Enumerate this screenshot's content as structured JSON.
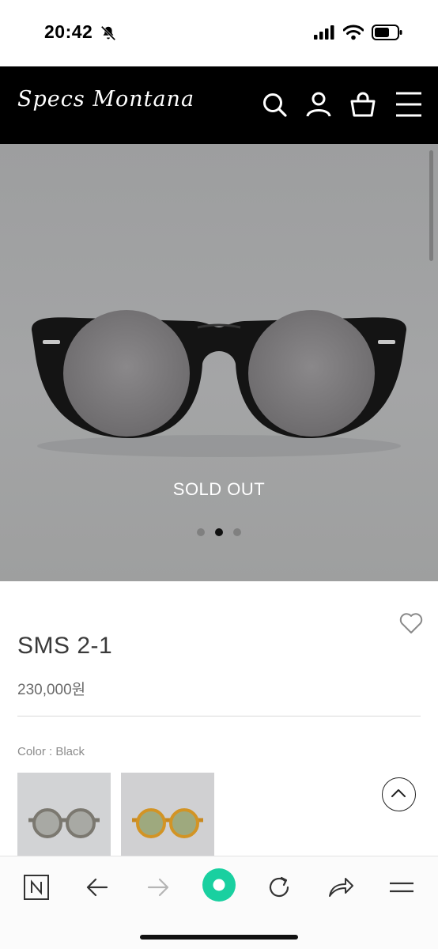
{
  "status_bar": {
    "time": "20:42",
    "icons": [
      "bell-off-icon",
      "cellular-signal-icon",
      "wifi-icon",
      "battery-icon"
    ]
  },
  "header": {
    "logo_text": "Specs Montana",
    "background": "#000000",
    "icons": [
      "search-icon",
      "account-icon",
      "cart-icon",
      "menu-icon"
    ]
  },
  "hero": {
    "badge": "SOLD OUT",
    "slide_count": 3,
    "active_slide": 2
  },
  "product": {
    "name": "SMS 2-1",
    "price": "230,000원",
    "color_label": "Color : Black",
    "swatch_icons": [
      "swatch-grey-frame",
      "swatch-amber-frame"
    ]
  },
  "browser_toolbar": {
    "icons": [
      "naver-n-icon",
      "back-arrow-icon",
      "forward-arrow-icon",
      "green-dot-icon",
      "refresh-icon",
      "share-icon",
      "menu-icon"
    ],
    "accent_color": "#19d0a0"
  }
}
